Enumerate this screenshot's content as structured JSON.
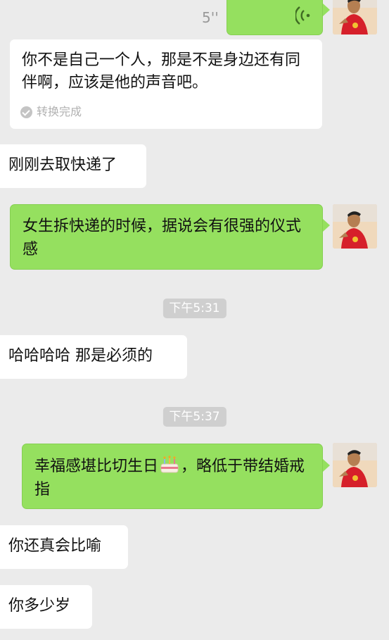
{
  "voice_message": {
    "duration": "5''"
  },
  "transcription": {
    "text": "你不是自己一个人，那是不是身边还有同伴啊，应该是他的声音吧。",
    "status": "转换完成"
  },
  "messages": [
    {
      "side": "left",
      "text": "刚刚去取快递了"
    },
    {
      "side": "right",
      "text": "女生拆快递的时候，据说会有很强的仪式感"
    },
    {
      "side": "left",
      "text": "哈哈哈哈 那是必须的"
    },
    {
      "side": "right",
      "text_before_emoji": "幸福感堪比切生日",
      "emoji": "birthday-cake",
      "text_after_emoji": "，略低于带结婚戒指"
    },
    {
      "side": "left",
      "text": "你还真会比喻"
    },
    {
      "side": "left",
      "text": "你多少岁"
    }
  ],
  "timestamps": [
    "下午5:31",
    "下午5:37"
  ],
  "colors": {
    "background": "#ebebeb",
    "outgoing_bubble": "#95e05f",
    "incoming_bubble": "#ffffff",
    "timestamp_pill": "#cfcfcf"
  },
  "icons": [
    "voice-wave-icon",
    "check-circle-icon",
    "birthday-cake-emoji",
    "avatar"
  ]
}
